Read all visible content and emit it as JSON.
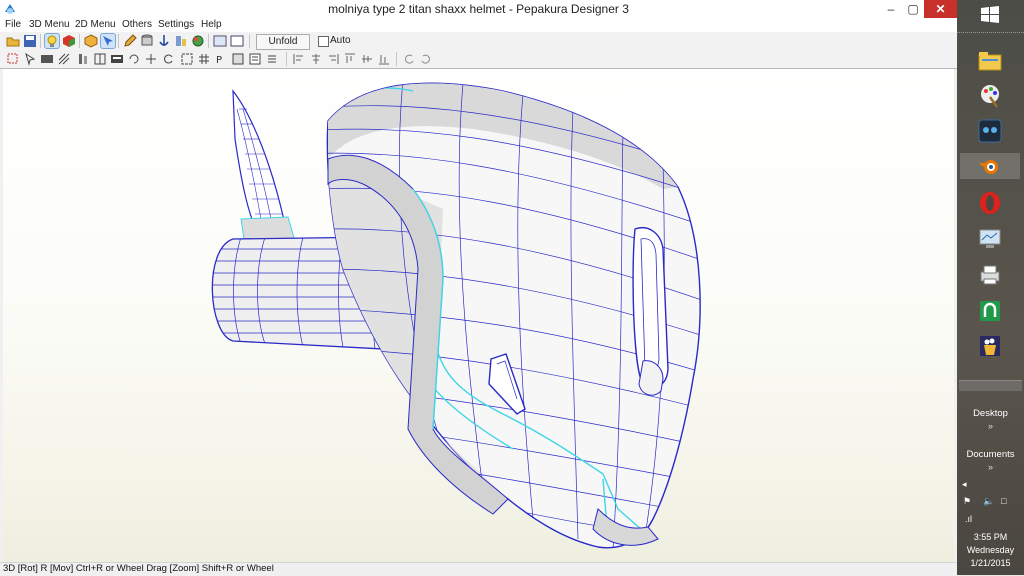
{
  "window": {
    "title": "molniya type 2 titan shaxx helmet  - Pepakura Designer 3",
    "controls": {
      "minimize": "–",
      "maximize": "▢",
      "close": "✕"
    }
  },
  "menu": {
    "items": [
      {
        "label": "File"
      },
      {
        "label": "3D Menu"
      },
      {
        "label": "2D Menu"
      },
      {
        "label": "Others"
      },
      {
        "label": "Settings"
      },
      {
        "label": "Help"
      }
    ]
  },
  "toolbar": {
    "unfold_label": "Unfold",
    "auto_label": "Auto",
    "auto_checked": false
  },
  "status": {
    "text": "3D [Rot] R [Mov] Ctrl+R or Wheel Drag [Zoom] Shift+R or Wheel"
  },
  "taskbar": {
    "desktop_label": "Desktop",
    "documents_label": "Documents",
    "chevron": "»",
    "clock": {
      "time": "3:55 PM",
      "day": "Wednesday",
      "date": "1/21/2015"
    }
  },
  "colors": {
    "mesh_edge": "#2a2ac8",
    "fold_edge": "#3fd6e8",
    "close_red": "#c7302b"
  }
}
